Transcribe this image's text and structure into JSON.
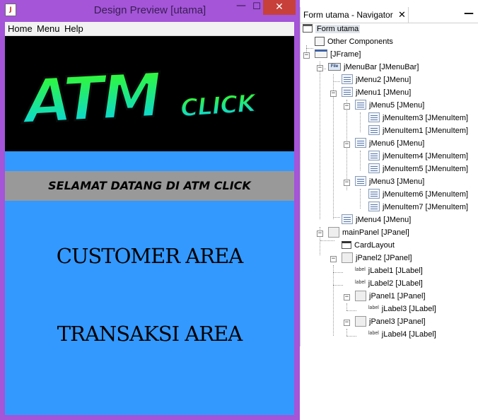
{
  "window": {
    "title": "Design Preview [utama]",
    "java_icon_text": "J",
    "minimize_glyph": "—",
    "maximize_glyph": "☐",
    "close_glyph": "✕",
    "close_color": "#c7403a",
    "frame_color": "#a455d8"
  },
  "menubar": {
    "items": [
      {
        "label": "Home"
      },
      {
        "label": "Menu"
      },
      {
        "label": "Help"
      }
    ]
  },
  "banner": {
    "logo_text": "ATM",
    "logo_sub": "CLICK",
    "logo_gradient": [
      "#39ff14",
      "#00d0ff"
    ]
  },
  "content": {
    "background": "#3399ff",
    "welcome": "SELAMAT DATANG DI ATM CLICK",
    "customer_area": "CUSTOMER AREA",
    "transaksi_area": "TRANSAKSI AREA"
  },
  "navigator": {
    "tab_title": "Form utama - Navigator",
    "close_glyph": "✕",
    "minimize_glyph": "—",
    "tree": [
      {
        "label": "Form utama",
        "icon": "form-icon",
        "selected": true
      },
      {
        "label": "Other Components",
        "icon": "other-components-icon"
      },
      {
        "label": "[JFrame]",
        "icon": "frame-icon"
      },
      {
        "label": "jMenuBar [JMenuBar]",
        "icon": "menubar-icon",
        "icon_text": "File"
      },
      {
        "label": "jMenu2 [JMenu]",
        "icon": "menu-icon"
      },
      {
        "label": "jMenu1 [JMenu]",
        "icon": "menu-icon"
      },
      {
        "label": "jMenu5 [JMenu]",
        "icon": "menu-icon"
      },
      {
        "label": "jMenuItem3 [JMenuItem]",
        "icon": "menuitem-icon"
      },
      {
        "label": "jMenuItem1 [JMenuItem]",
        "icon": "menuitem-icon"
      },
      {
        "label": "jMenu6 [JMenu]",
        "icon": "menu-icon"
      },
      {
        "label": "jMenuItem4 [JMenuItem]",
        "icon": "menuitem-icon"
      },
      {
        "label": "jMenuItem5 [JMenuItem]",
        "icon": "menuitem-icon"
      },
      {
        "label": "jMenu3 [JMenu]",
        "icon": "menu-icon"
      },
      {
        "label": "jMenuItem6 [JMenuItem]",
        "icon": "menuitem-icon"
      },
      {
        "label": "jMenuItem7 [JMenuItem]",
        "icon": "menuitem-icon"
      },
      {
        "label": "jMenu4 [JMenu]",
        "icon": "menu-icon"
      },
      {
        "label": "mainPanel [JPanel]",
        "icon": "panel-icon"
      },
      {
        "label": "CardLayout",
        "icon": "cardlayout-icon"
      },
      {
        "label": "jPanel2 [JPanel]",
        "icon": "panel-icon"
      },
      {
        "label": "jLabel1 [JLabel]",
        "icon": "label-icon",
        "icon_text": "label"
      },
      {
        "label": "jLabel2 [JLabel]",
        "icon": "label-icon",
        "icon_text": "label"
      },
      {
        "label": "jPanel1 [JPanel]",
        "icon": "panel-icon"
      },
      {
        "label": "jLabel3 [JLabel]",
        "icon": "label-icon",
        "icon_text": "label"
      },
      {
        "label": "jPanel3 [JPanel]",
        "icon": "panel-icon"
      },
      {
        "label": "jLabel4 [JLabel]",
        "icon": "label-icon",
        "icon_text": "label"
      }
    ],
    "toggle_collapse": "−"
  }
}
